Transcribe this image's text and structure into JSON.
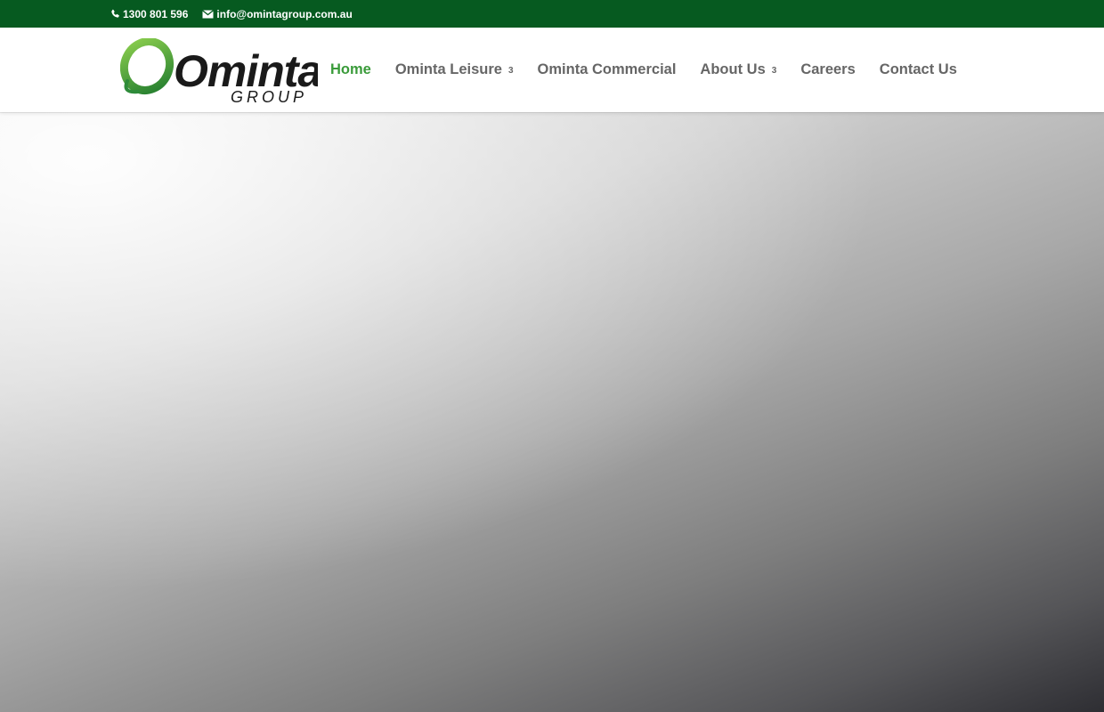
{
  "topbar": {
    "phone": "1300 801 596",
    "email": "info@omintagroup.com.au",
    "background": "#065a20"
  },
  "logo": {
    "word": "Ominta",
    "sub": "GROUP"
  },
  "nav": {
    "items": [
      {
        "label": "Home",
        "active": true,
        "dropdown": false
      },
      {
        "label": "Ominta Leisure",
        "active": false,
        "dropdown": true
      },
      {
        "label": "Ominta Commercial",
        "active": false,
        "dropdown": false
      },
      {
        "label": "About Us",
        "active": false,
        "dropdown": true
      },
      {
        "label": "Careers",
        "active": false,
        "dropdown": false
      },
      {
        "label": "Contact Us",
        "active": false,
        "dropdown": false
      }
    ],
    "active_color": "#3a9b3a",
    "text_color": "#666666",
    "dropdown_glyph": "3"
  }
}
